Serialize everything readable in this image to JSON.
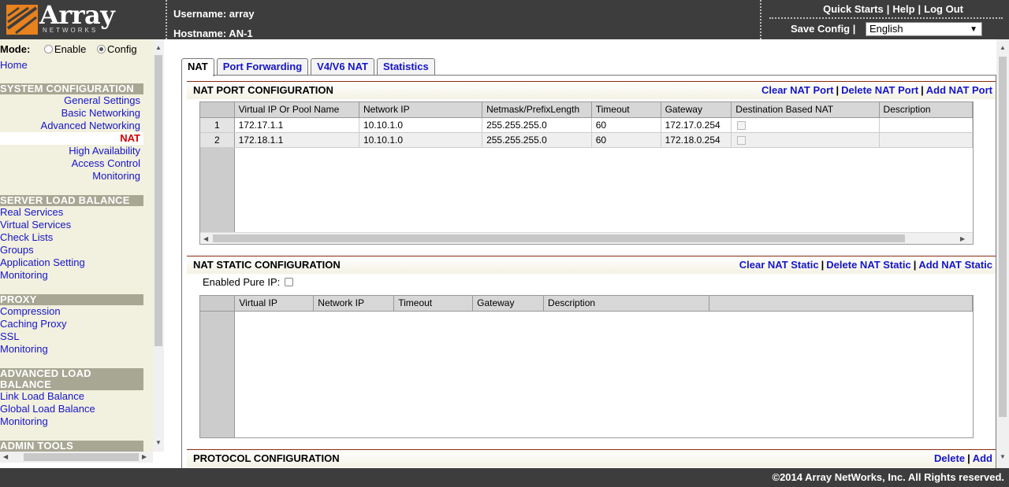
{
  "header": {
    "logo_text": "Array",
    "logo_sub": "NETWORKS",
    "username_label": "Username: array",
    "hostname_label": "Hostname: AN-1",
    "links": [
      "Quick Starts",
      "Help",
      "Log Out"
    ],
    "save_config": "Save Config",
    "language": "English",
    "brand_color": "#e8821e"
  },
  "sidebar": {
    "mode_label": "Mode:",
    "mode_enable": "Enable",
    "mode_config": "Config",
    "mode_selected": "Config",
    "home": "Home",
    "system_config": {
      "title": "SYSTEM CONFIGURATION",
      "items": [
        "General Settings",
        "Basic Networking",
        "Advanced Networking",
        "NAT",
        "High Availability",
        "Access Control",
        "Monitoring"
      ],
      "active": "NAT"
    },
    "slb": {
      "title": "SERVER LOAD BALANCE",
      "items": [
        "Real Services",
        "Virtual Services",
        "Check Lists",
        "Groups",
        "Application Setting",
        "Monitoring"
      ]
    },
    "proxy": {
      "title": "PROXY",
      "items": [
        "Compression",
        "Caching Proxy",
        "SSL",
        "Monitoring"
      ]
    },
    "alb": {
      "title": "ADVANCED LOAD BALANCE",
      "items": [
        "Link Load Balance",
        "Global Load Balance",
        "Monitoring"
      ]
    },
    "admin": {
      "title": "ADMIN TOOLS"
    }
  },
  "tabs": [
    "NAT",
    "Port Forwarding",
    "V4/V6 NAT",
    "Statistics"
  ],
  "nat_port": {
    "title": "NAT PORT CONFIGURATION",
    "actions": [
      "Clear NAT Port",
      "Delete NAT Port",
      "Add NAT Port"
    ],
    "columns": [
      "Virtual IP Or Pool Name",
      "Network IP",
      "Netmask/PrefixLength",
      "Timeout",
      "Gateway",
      "Destination Based NAT",
      "Description"
    ],
    "rows": [
      {
        "num": "1",
        "vip": "172.17.1.1",
        "network_ip": "10.10.1.0",
        "netmask": "255.255.255.0",
        "timeout": "60",
        "gateway": "172.17.0.254",
        "dest_nat": false,
        "description": ""
      },
      {
        "num": "2",
        "vip": "172.18.1.1",
        "network_ip": "10.10.1.0",
        "netmask": "255.255.255.0",
        "timeout": "60",
        "gateway": "172.18.0.254",
        "dest_nat": false,
        "description": ""
      }
    ]
  },
  "nat_static": {
    "title": "NAT STATIC CONFIGURATION",
    "actions": [
      "Clear NAT Static",
      "Delete NAT Static",
      "Add NAT Static"
    ],
    "enabled_pure_ip_label": "Enabled Pure IP:",
    "columns": [
      "Virtual IP",
      "Network IP",
      "Timeout",
      "Gateway",
      "Description"
    ]
  },
  "protocol": {
    "title": "PROTOCOL CONFIGURATION",
    "actions": [
      "Delete",
      "Add"
    ]
  },
  "footer": {
    "copyright": "©2014 Array NetWorks, Inc. All Rights reserved."
  }
}
